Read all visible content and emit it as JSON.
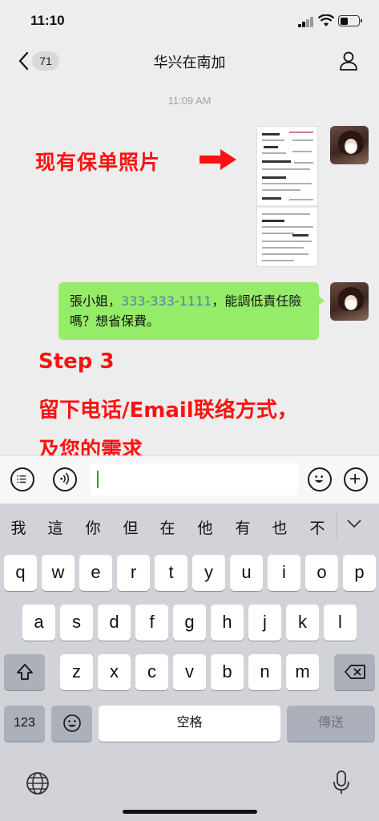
{
  "status": {
    "time": "11:10"
  },
  "nav": {
    "badge": "71",
    "title": "华兴在南加"
  },
  "chat": {
    "timestamp": "11:09 AM",
    "annotation_photo": "现有保单照片",
    "message": {
      "prefix": "張小姐，",
      "phone": "333-333-1111",
      "suffix": "，能調低責任險嗎？想省保費。"
    },
    "annotation_step": "Step 3",
    "annotation_line2": "留下电话/Email联络方式，",
    "annotation_line3": "及您的需求"
  },
  "input": {
    "value": ""
  },
  "keyboard": {
    "candidates": [
      "我",
      "這",
      "你",
      "但",
      "在",
      "他",
      "有",
      "也",
      "不"
    ],
    "row1": [
      "q",
      "w",
      "e",
      "r",
      "t",
      "y",
      "u",
      "i",
      "o",
      "p"
    ],
    "row2": [
      "a",
      "s",
      "d",
      "f",
      "g",
      "h",
      "j",
      "k",
      "l"
    ],
    "row3": [
      "z",
      "x",
      "c",
      "v",
      "b",
      "n",
      "m"
    ],
    "numbers": "123",
    "space": "空格",
    "send": "傳送"
  },
  "colors": {
    "bubble": "#95ec69",
    "annotation": "#ff1111",
    "caret": "#1aad19"
  },
  "icons": [
    "signal-icon",
    "wifi-icon",
    "battery-icon",
    "back-chevron-icon",
    "person-icon",
    "voice-list-icon",
    "voice-wave-icon",
    "emoji-icon",
    "plus-icon",
    "shift-icon",
    "delete-icon",
    "globe-icon",
    "microphone-icon"
  ]
}
